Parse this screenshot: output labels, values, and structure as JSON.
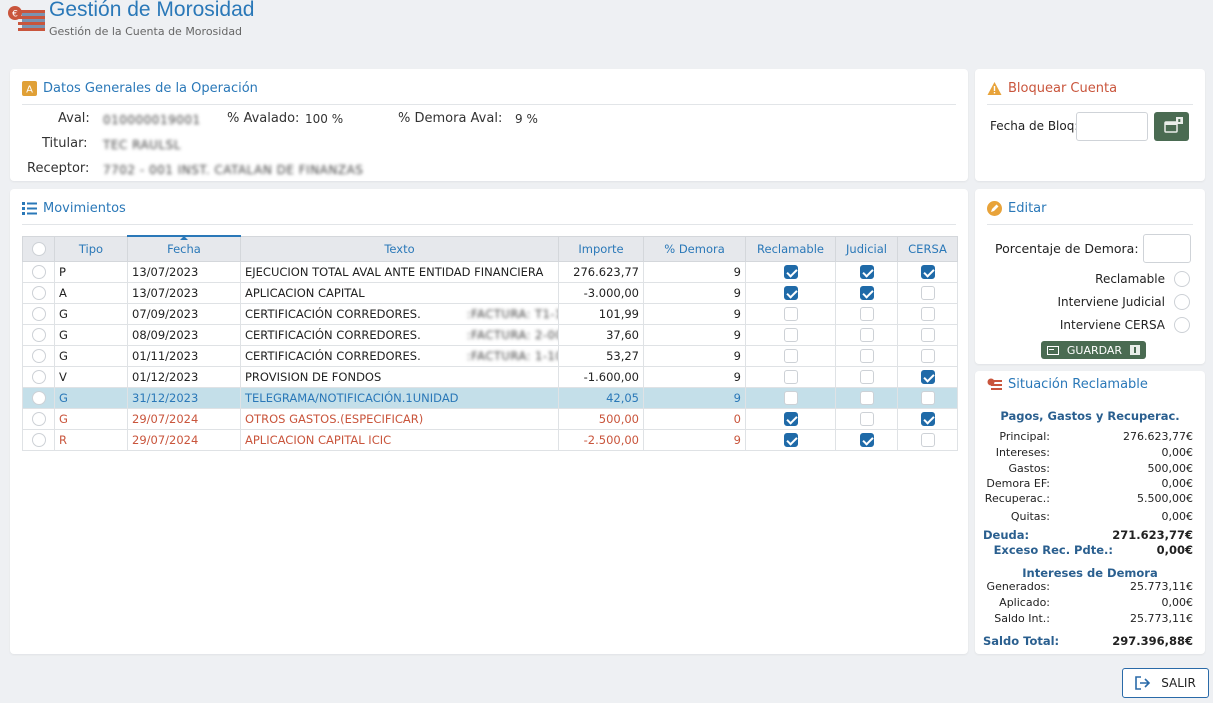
{
  "header": {
    "title": "Gestión de Morosidad",
    "subtitle": "Gestión de la Cuenta de Morosidad"
  },
  "datos": {
    "title": "Datos Generales de la Operación",
    "aval_label": "Aval:",
    "aval_value": "010000019001",
    "avalado_label": "% Avalado:",
    "avalado_value": "100 %",
    "demora_label": "% Demora Aval:",
    "demora_value": "9 %",
    "titular_label": "Titular:",
    "titular_value": "TEC RAULSL",
    "receptor_label": "Receptor:",
    "receptor_value": "7702 - 001 INST. CATALAN DE FINANZAS"
  },
  "movimientos": {
    "title": "Movimientos",
    "columns": [
      "Tipo",
      "Fecha",
      "Texto",
      "Importe",
      "% Demora",
      "Reclamable",
      "Judicial",
      "CERSA"
    ],
    "rows": [
      {
        "tipo": "P",
        "fecha": "13/07/2023",
        "texto": "EJECUCION TOTAL AVAL ANTE ENTIDAD FINANCIERA",
        "blur": "",
        "importe": "276.623,77",
        "demora": "9",
        "reclamable": true,
        "judicial": true,
        "cersa": true,
        "state": ""
      },
      {
        "tipo": "A",
        "fecha": "13/07/2023",
        "texto": "APLICACION CAPITAL",
        "blur": "",
        "importe": "-3.000,00",
        "demora": "9",
        "reclamable": true,
        "judicial": true,
        "cersa": false,
        "state": ""
      },
      {
        "tipo": "G",
        "fecha": "07/09/2023",
        "texto": "CERTIFICACIÓN CORREDORES.",
        "blur": ":FACTURA: T1-17...",
        "importe": "101,99",
        "demora": "9",
        "reclamable": false,
        "judicial": false,
        "cersa": false,
        "state": ""
      },
      {
        "tipo": "G",
        "fecha": "08/09/2023",
        "texto": "CERTIFICACIÓN CORREDORES.",
        "blur": ":FACTURA: 2-000...",
        "importe": "37,60",
        "demora": "9",
        "reclamable": false,
        "judicial": false,
        "cersa": false,
        "state": ""
      },
      {
        "tipo": "G",
        "fecha": "01/11/2023",
        "texto": "CERTIFICACIÓN CORREDORES.",
        "blur": ":FACTURA: 1-1000...",
        "importe": "53,27",
        "demora": "9",
        "reclamable": false,
        "judicial": false,
        "cersa": false,
        "state": ""
      },
      {
        "tipo": "V",
        "fecha": "01/12/2023",
        "texto": "PROVISION DE FONDOS",
        "blur": "",
        "importe": "-1.600,00",
        "demora": "9",
        "reclamable": false,
        "judicial": false,
        "cersa": true,
        "state": ""
      },
      {
        "tipo": "G",
        "fecha": "31/12/2023",
        "texto": "TELEGRAMA/NOTIFICACIÓN.1UNIDAD",
        "blur": "",
        "importe": "42,05",
        "demora": "9",
        "reclamable": false,
        "judicial": false,
        "cersa": false,
        "state": "sel"
      },
      {
        "tipo": "G",
        "fecha": "29/07/2024",
        "texto": "OTROS GASTOS.(ESPECIFICAR)",
        "blur": "",
        "importe": "500,00",
        "demora": "0",
        "reclamable": true,
        "judicial": false,
        "cersa": true,
        "state": "red"
      },
      {
        "tipo": "R",
        "fecha": "29/07/2024",
        "texto": "APLICACION CAPITAL ICIC",
        "blur": "",
        "importe": "-2.500,00",
        "demora": "9",
        "reclamable": true,
        "judicial": true,
        "cersa": false,
        "state": "red"
      }
    ]
  },
  "bloquear": {
    "title": "Bloquear Cuenta",
    "fecha_label": "Fecha de Bloq:",
    "fecha_value": ""
  },
  "editar": {
    "title": "Editar",
    "porcentaje_label": "Porcentaje de Demora:",
    "porcentaje_value": "",
    "reclamable_label": "Reclamable",
    "judicial_label": "Interviene Judicial",
    "cersa_label": "Interviene CERSA",
    "guardar_label": "GUARDAR"
  },
  "situacion": {
    "title": "Situación Reclamable",
    "section1": "Pagos, Gastos y Recuperac.",
    "principal_label": "Principal:",
    "principal": "276.623,77€",
    "intereses_label": "Intereses:",
    "intereses": "0,00€",
    "gastos_label": "Gastos:",
    "gastos": "500,00€",
    "demora_ef_label": "Demora EF:",
    "demora_ef": "0,00€",
    "recuperac_label": "Recuperac.:",
    "recuperac": "5.500,00€",
    "quitas_label": "Quitas:",
    "quitas": "0,00€",
    "deuda_label": "Deuda:",
    "deuda": "271.623,77€",
    "exceso_label": "Exceso Rec. Pdte.:",
    "exceso": "0,00€",
    "section2": "Intereses de Demora",
    "generados_label": "Generados:",
    "generados": "25.773,11€",
    "aplicado_label": "Aplicado:",
    "aplicado": "0,00€",
    "saldo_int_label": "Saldo Int.:",
    "saldo_int": "25.773,11€",
    "saldo_total_label": "Saldo Total:",
    "saldo_total": "297.396,88€"
  },
  "salir_label": "SALIR",
  "colors": {
    "accent": "#2a78b8",
    "warn": "#c9553c",
    "green_button": "#4a6b52",
    "selected_row": "#c4dfe9",
    "checked": "#1f6aa8"
  }
}
